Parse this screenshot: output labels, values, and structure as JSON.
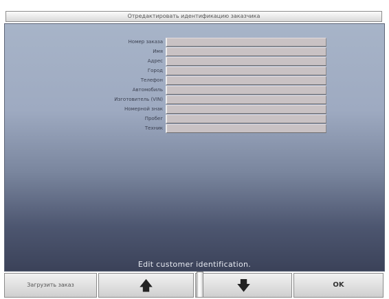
{
  "window": {
    "title": "Отредактировать идентификацию заказчика"
  },
  "form": {
    "fields": [
      {
        "label": "Номер заказа",
        "value": ""
      },
      {
        "label": "Имя",
        "value": ""
      },
      {
        "label": "Адрес",
        "value": ""
      },
      {
        "label": "Город",
        "value": ""
      },
      {
        "label": "Телефон",
        "value": ""
      },
      {
        "label": "Автомобиль",
        "value": ""
      },
      {
        "label": "Изготовитель (VIN)",
        "value": ""
      },
      {
        "label": "Номерной знак",
        "value": ""
      },
      {
        "label": "Пробег",
        "value": ""
      },
      {
        "label": "Техник",
        "value": ""
      }
    ]
  },
  "status": {
    "message": "Edit customer identification."
  },
  "toolbar": {
    "load_label": "Загрузить заказ",
    "up_icon": "arrow-up-icon",
    "down_icon": "arrow-down-icon",
    "ok_label": "OK"
  }
}
